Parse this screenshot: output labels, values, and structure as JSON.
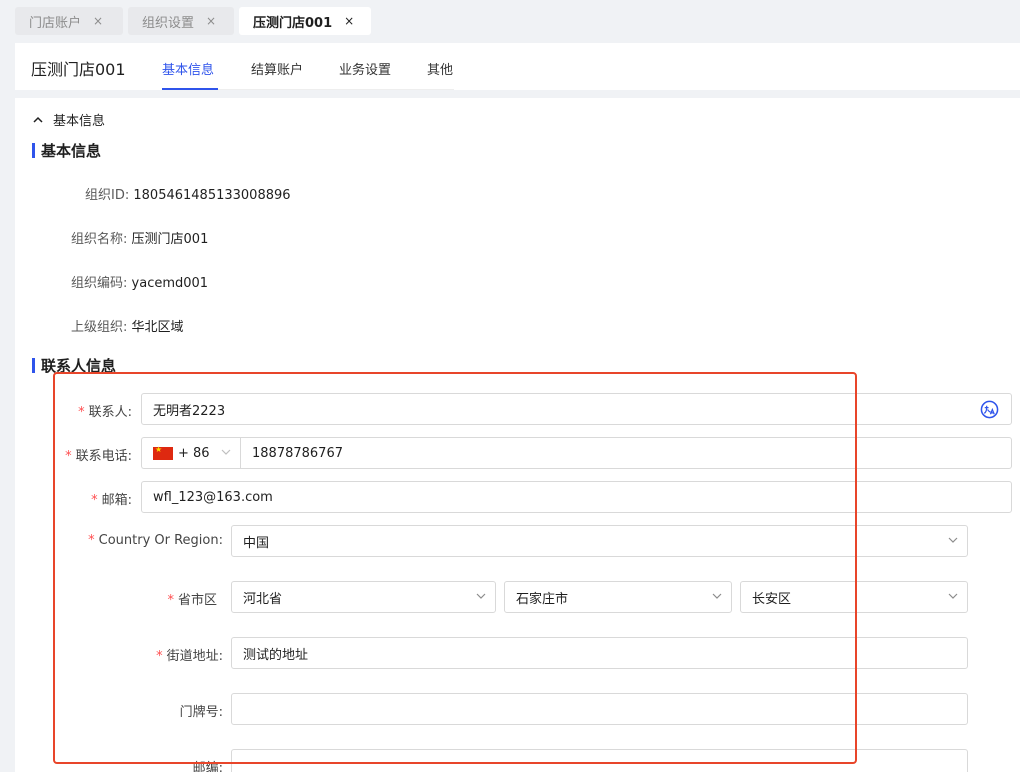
{
  "tabs": [
    {
      "label": "门店账户",
      "close": "×"
    },
    {
      "label": "组织设置",
      "close": "×"
    },
    {
      "label": "压测门店001",
      "close": "×"
    }
  ],
  "header": {
    "store_name": "压测门店001",
    "nav": [
      "基本信息",
      "结算账户",
      "业务设置",
      "其他"
    ]
  },
  "collapse_label": "基本信息",
  "sections": {
    "basic_title": "基本信息",
    "contact_title": "联系人信息"
  },
  "basic_info": [
    {
      "label": "组织ID:",
      "value": "1805461485133008896"
    },
    {
      "label": "组织名称:",
      "value": "压测门店001"
    },
    {
      "label": "组织编码:",
      "value": "yacemd001"
    },
    {
      "label": "上级组织:",
      "value": "华北区域"
    }
  ],
  "contact": {
    "contact_label": "联系人:",
    "contact_value": "无明者2223",
    "phone_label": "联系电话:",
    "phone_code": "+ 86",
    "phone_value": "18878786767",
    "email_label": "邮箱:",
    "email_value": "wfl_123@163.com",
    "country_label": "Country Or Region:",
    "country_value": "中国",
    "region_label": "省市区",
    "province": "河北省",
    "city": "石家庄市",
    "district": "长安区",
    "street_label": "街道地址:",
    "street_value": "测试的地址",
    "door_label": "门牌号:",
    "door_value": "",
    "zip_label": "邮编:"
  },
  "colors": {
    "accent": "#2f54eb",
    "required": "#ff4d4f",
    "highlight": "#e8452a"
  }
}
